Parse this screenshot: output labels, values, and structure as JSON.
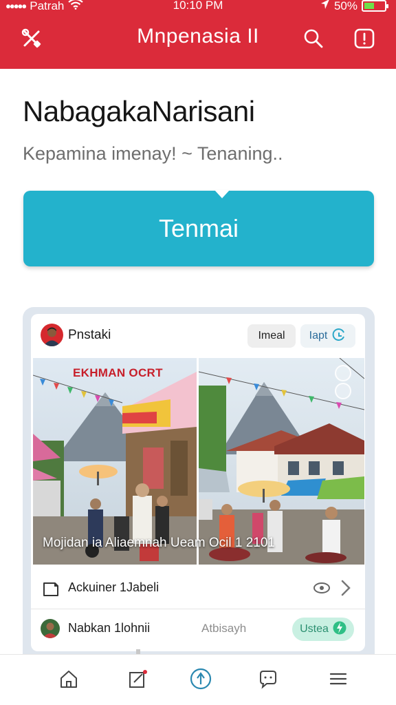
{
  "status": {
    "carrier": "Patrah",
    "time": "10:10 PM",
    "battery": "50%",
    "battery_level": 0.5
  },
  "header": {
    "title": "Mnpenasia II",
    "left_icon": "tools-icon",
    "right_icons": [
      "search-icon",
      "alert-icon"
    ]
  },
  "main": {
    "title": "NabagakaNarisani",
    "subtitle": "Kepamina imenay! ~ Tenaning..",
    "cta_label": "Tenmai"
  },
  "card": {
    "author": "Pnstaki",
    "actions": {
      "first": "Imeal",
      "second": "Iapt"
    },
    "photo_overlay": "EKHMAN OCRT",
    "photo_caption": "Mojidan ia Aliaemnah Ueam Ocil 1 2101",
    "rows": {
      "first_label": "Ackuiner 1Jabeli",
      "second_label": "Nabkan 1lohnii",
      "second_meta": "Atbisayh",
      "second_badge": "Ustea"
    }
  },
  "tabbar": {
    "tabs": [
      "home-icon",
      "compose-icon",
      "explore-icon",
      "chat-icon",
      "menu-icon"
    ]
  },
  "colors": {
    "header": "#db2b3a",
    "accent": "#23b2cc",
    "badge": "#c9f0e2",
    "tab_active": "#2a88b0"
  }
}
